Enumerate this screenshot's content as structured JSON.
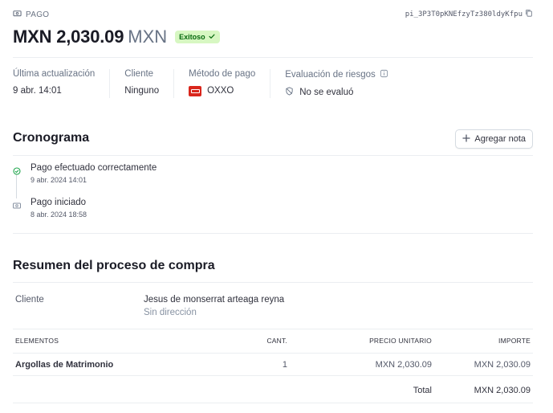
{
  "header": {
    "section_label": "PAGO",
    "payment_id": "pi_3P3T0pKNEfzyTz380ldyKfpu",
    "amount": "MXN 2,030.09",
    "currency": "MXN",
    "status": "Exitoso"
  },
  "details": [
    {
      "label": "Última actualización",
      "value": "9 abr. 14:01"
    },
    {
      "label": "Cliente",
      "value": "Ninguno"
    },
    {
      "label": "Método de pago",
      "value": "OXXO"
    },
    {
      "label": "Evaluación de riesgos",
      "value": "No se evaluó"
    }
  ],
  "timeline": {
    "title": "Cronograma",
    "add_note_label": "Agregar nota",
    "events": [
      {
        "title": "Pago efectuado correctamente",
        "date": "9 abr. 2024 14:01"
      },
      {
        "title": "Pago iniciado",
        "date": "8 abr. 2024 18:58"
      }
    ]
  },
  "summary": {
    "title": "Resumen del proceso de compra",
    "customer_label": "Cliente",
    "customer_name": "Jesus de monserrat arteaga reyna",
    "customer_address": "Sin dirección",
    "columns": [
      "ELEMENTOS",
      "CANT.",
      "PRECIO UNITARIO",
      "IMPORTE"
    ],
    "rows": [
      {
        "item": "Argollas de Matrimonio",
        "qty": "1",
        "unit_price": "MXN 2,030.09",
        "amount": "MXN 2,030.09"
      }
    ],
    "total_label": "Total",
    "total_value": "MXN 2,030.09"
  },
  "colors": {
    "success_bg": "#d7f7c2",
    "success_text": "#05690d",
    "oxxo_red": "#d9261c",
    "text_primary": "#1a1b25",
    "text_muted": "#687385"
  }
}
